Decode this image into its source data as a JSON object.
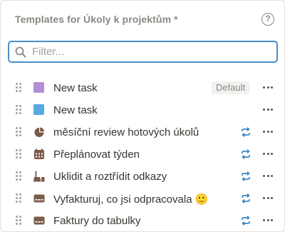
{
  "header": {
    "title": "Templates for Úkoly k projektům *",
    "help_symbol": "?"
  },
  "search": {
    "placeholder": "Filter...",
    "value": ""
  },
  "colors": {
    "accent": "#4a8ec9",
    "purple_swatch": "#b28fd6",
    "blue_swatch": "#58aae0",
    "icon_brown": "#7a5a48",
    "repeat_blue": "#3f86c4"
  },
  "templates": [
    {
      "label": "New task",
      "icon": "purple-square-icon",
      "badge": "Default",
      "repeat": false
    },
    {
      "label": "New task",
      "icon": "blue-square-icon",
      "badge": "",
      "repeat": false
    },
    {
      "label": "měsíční review hotových úkolů",
      "icon": "pie-chart-icon",
      "badge": "",
      "repeat": true
    },
    {
      "label": "Přeplánovat týden",
      "icon": "calendar-icon",
      "badge": "",
      "repeat": true
    },
    {
      "label": "Uklidit a roztřídit odkazy",
      "icon": "broom-icon",
      "badge": "",
      "repeat": true
    },
    {
      "label": "Vyfakturuj, co jsi odpracovala 🙂",
      "icon": "card-icon",
      "badge": "",
      "repeat": true
    },
    {
      "label": "Faktury do tabulky",
      "icon": "card-icon",
      "badge": "",
      "repeat": true
    }
  ]
}
